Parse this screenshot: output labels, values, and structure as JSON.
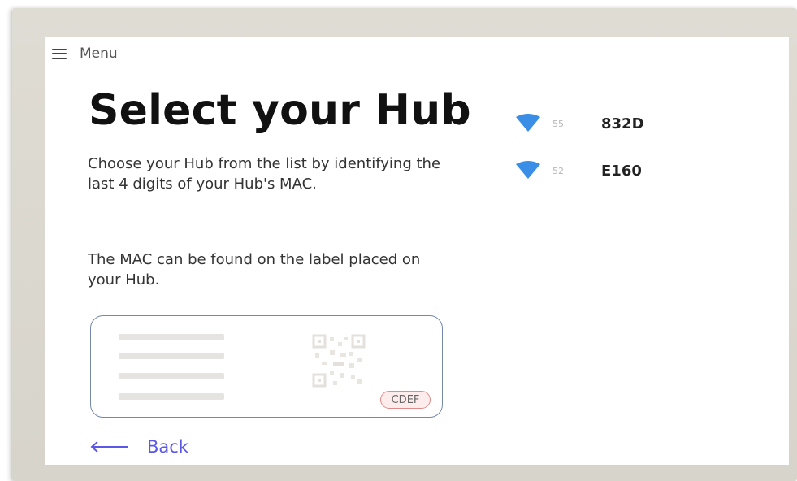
{
  "menu": {
    "icon": "hamburger-menu-icon",
    "label": "Menu"
  },
  "page": {
    "title": "Select your Hub",
    "instruction": "Choose your Hub from the list by identifying the last 4 digits of your Hub's MAC.",
    "mac_note": "The MAC can be found on the label placed on your Hub."
  },
  "label_illustration": {
    "mac_suffix": "CDEF",
    "highlight_color": "#e18a8a"
  },
  "hubs": [
    {
      "signal": "55",
      "id": "832D",
      "icon": "wifi-signal-icon"
    },
    {
      "signal": "52",
      "id": "E160",
      "icon": "wifi-signal-icon"
    }
  ],
  "back": {
    "icon": "arrow-left-icon",
    "label": "Back"
  },
  "colors": {
    "accent": "#5b57e8",
    "wifi": "#3a8ee6",
    "card_border": "#7489a8",
    "frame": "#dcd9d0"
  }
}
